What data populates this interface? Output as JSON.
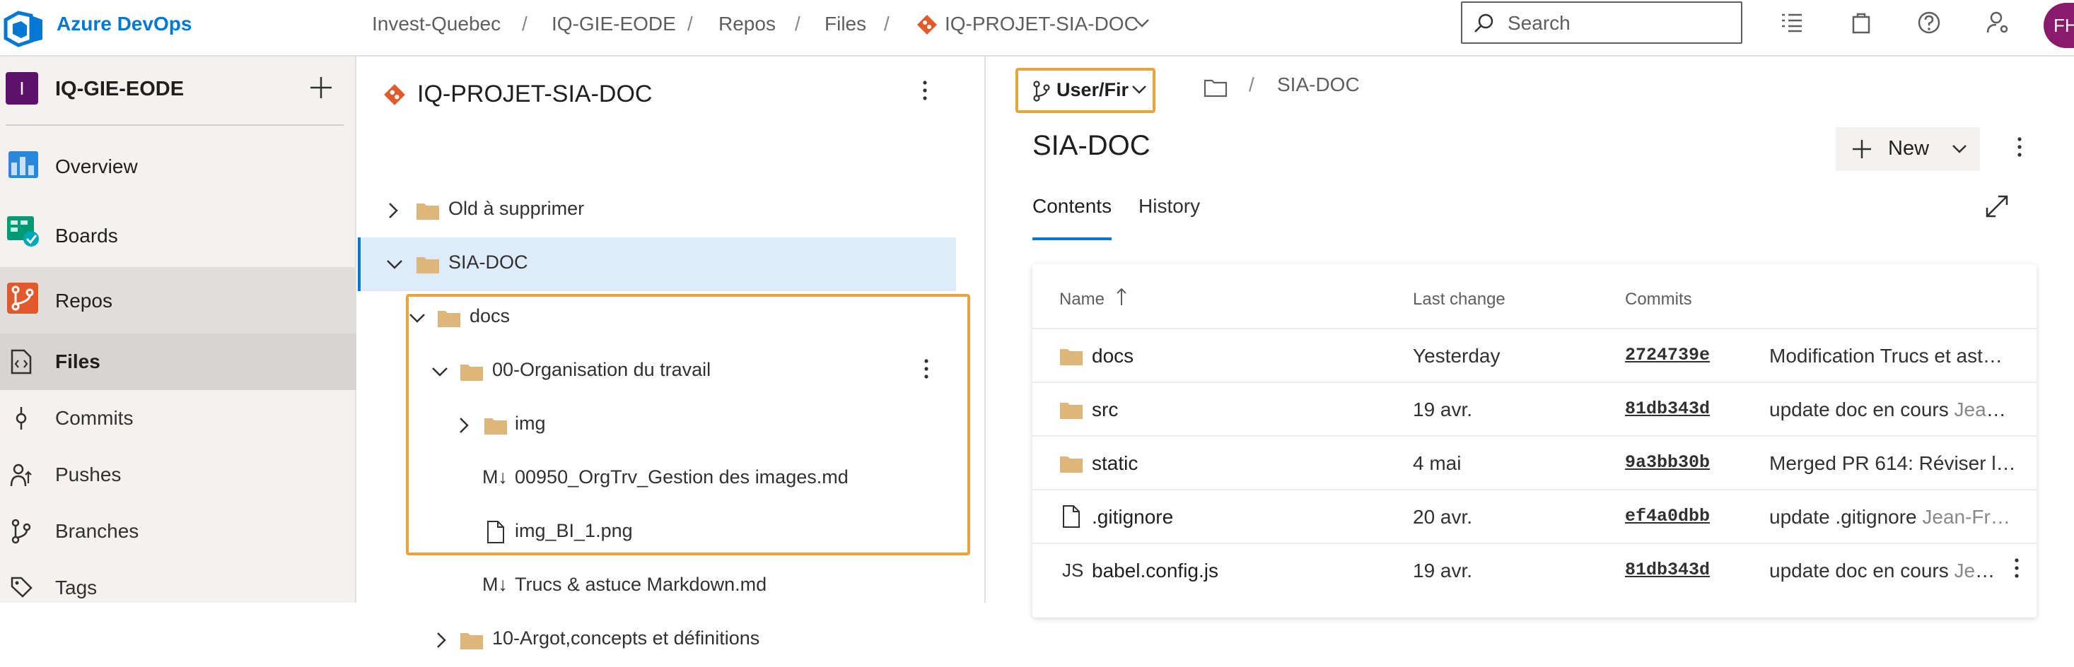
{
  "header": {
    "brand": "Azure DevOps",
    "breadcrumb": [
      "Invest-Quebec",
      "IQ-GIE-EODE",
      "Repos",
      "Files",
      "IQ-PROJET-SIA-DOC"
    ],
    "breadcrumb_sep": "/",
    "search_placeholder": "Search",
    "avatar_initials": "FH",
    "brand_color": "#0078d4"
  },
  "sidebar": {
    "project_initial": "I",
    "project_name": "IQ-GIE-EODE",
    "items": [
      {
        "label": "Overview",
        "icon": "overview-icon"
      },
      {
        "label": "Boards",
        "icon": "boards-icon"
      },
      {
        "label": "Repos",
        "icon": "repos-icon"
      }
    ],
    "repo_items": [
      {
        "label": "Files",
        "icon": "files-icon",
        "active": true
      },
      {
        "label": "Commits",
        "icon": "commits-icon"
      },
      {
        "label": "Pushes",
        "icon": "pushes-icon"
      },
      {
        "label": "Branches",
        "icon": "branches-icon"
      },
      {
        "label": "Tags",
        "icon": "tags-icon"
      }
    ]
  },
  "tree": {
    "repo_name": "IQ-PROJET-SIA-DOC",
    "rows": [
      {
        "label": "Old à supprimer",
        "kind": "folder",
        "expanded": false
      },
      {
        "label": "SIA-DOC",
        "kind": "folder",
        "expanded": true,
        "selected": true
      },
      {
        "label": "docs",
        "kind": "folder",
        "expanded": true
      },
      {
        "label": "00-Organisation du travail",
        "kind": "folder",
        "expanded": true
      },
      {
        "label": "img",
        "kind": "folder",
        "expanded": false
      },
      {
        "label": "00950_OrgTrv_Gestion des images.md",
        "kind": "markdown"
      },
      {
        "label": "img_BI_1.png",
        "kind": "file"
      },
      {
        "label": "Trucs & astuce Markdown.md",
        "kind": "markdown"
      },
      {
        "label": "10-Argot,concepts et définitions",
        "kind": "folder",
        "expanded": false
      }
    ],
    "markdown_glyph": "M↓"
  },
  "main": {
    "branch": "User/Fir",
    "path_sep": "/",
    "path_name": "SIA-DOC",
    "title": "SIA-DOC",
    "new_label": "New",
    "tabs": [
      "Contents",
      "History"
    ],
    "columns": {
      "name": "Name",
      "last_change": "Last change",
      "commits": "Commits"
    },
    "rows": [
      {
        "name": "docs",
        "kind": "folder",
        "date": "Yesterday",
        "hash": "2724739e",
        "message": "Modification Trucs et ast…",
        "author": ""
      },
      {
        "name": "src",
        "kind": "folder",
        "date": "19 avr.",
        "hash": "81db343d",
        "message": "update doc en cours",
        "author": "Jean…"
      },
      {
        "name": "static",
        "kind": "folder",
        "date": "4 mai",
        "hash": "9a3bb30b",
        "message": "Merged PR 614: Réviser l…",
        "author": ""
      },
      {
        "name": ".gitignore",
        "kind": "file",
        "date": "20 avr.",
        "hash": "ef4a0dbb",
        "message": "update .gitignore",
        "author": "Jean-Fr…"
      },
      {
        "name": "babel.config.js",
        "kind": "js",
        "date": "19 avr.",
        "hash": "81db343d",
        "message": "update doc en cours",
        "author": "Jean…"
      }
    ],
    "js_glyph": "JS",
    "highlight_color": "#e8a53b"
  }
}
